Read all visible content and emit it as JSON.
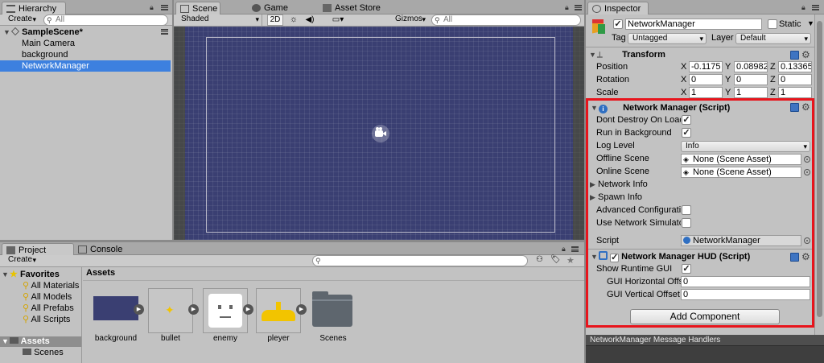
{
  "hierarchy": {
    "tab": "Hierarchy",
    "create": "Create",
    "search": "All",
    "scene": "SampleScene*",
    "items": [
      "Main Camera",
      "background",
      "NetworkManager"
    ]
  },
  "scene_view": {
    "tabs": [
      "Scene",
      "Game",
      "Asset Store"
    ],
    "shading": "Shaded",
    "mode_2d": "2D",
    "gizmos": "Gizmos",
    "search": "All"
  },
  "inspector": {
    "tab": "Inspector",
    "object_name": "NetworkManager",
    "static_label": "Static",
    "tag_label": "Tag",
    "tag": "Untagged",
    "layer_label": "Layer",
    "layer": "Default",
    "transform": {
      "title": "Transform",
      "rows": [
        {
          "label": "Position",
          "x": "-0.1175",
          "y": "0.08982",
          "z": "0.13365"
        },
        {
          "label": "Rotation",
          "x": "0",
          "y": "0",
          "z": "0"
        },
        {
          "label": "Scale",
          "x": "1",
          "y": "1",
          "z": "1"
        }
      ],
      "axes": [
        "X",
        "Y",
        "Z"
      ]
    },
    "network_manager": {
      "title": "Network Manager (Script)",
      "dont_destroy": "Dont Destroy On Load",
      "run_bg": "Run in Background",
      "log_level_label": "Log Level",
      "log_level": "Info",
      "offline_label": "Offline Scene",
      "offline": "None (Scene Asset)",
      "online_label": "Online Scene",
      "online": "None (Scene Asset)",
      "network_info": "Network Info",
      "spawn_info": "Spawn Info",
      "advanced": "Advanced Configuration",
      "use_sim": "Use Network Simulator",
      "script_label": "Script",
      "script": "NetworkManager"
    },
    "hud": {
      "title": "Network Manager HUD (Script)",
      "show_gui": "Show Runtime GUI",
      "h_label": "GUI Horizontal Offset",
      "h": "0",
      "v_label": "GUI Vertical Offset",
      "v": "0"
    },
    "add_component": "Add Component",
    "message_handlers": "NetworkManager Message Handlers"
  },
  "project": {
    "tabs": [
      "Project",
      "Console"
    ],
    "create": "Create",
    "search": "",
    "favorites": "Favorites",
    "fav_items": [
      "All Materials",
      "All Models",
      "All Prefabs",
      "All Scripts"
    ],
    "assets_root": "Assets",
    "assets_children": [
      "Scenes"
    ],
    "breadcrumb": "Assets",
    "assets": [
      "background",
      "bullet",
      "enemy",
      "pleyer",
      "Scenes"
    ]
  },
  "colors": {
    "scene_bg": "#3a3f72",
    "selection": "#3d80df",
    "highlight": "#e8141c"
  }
}
